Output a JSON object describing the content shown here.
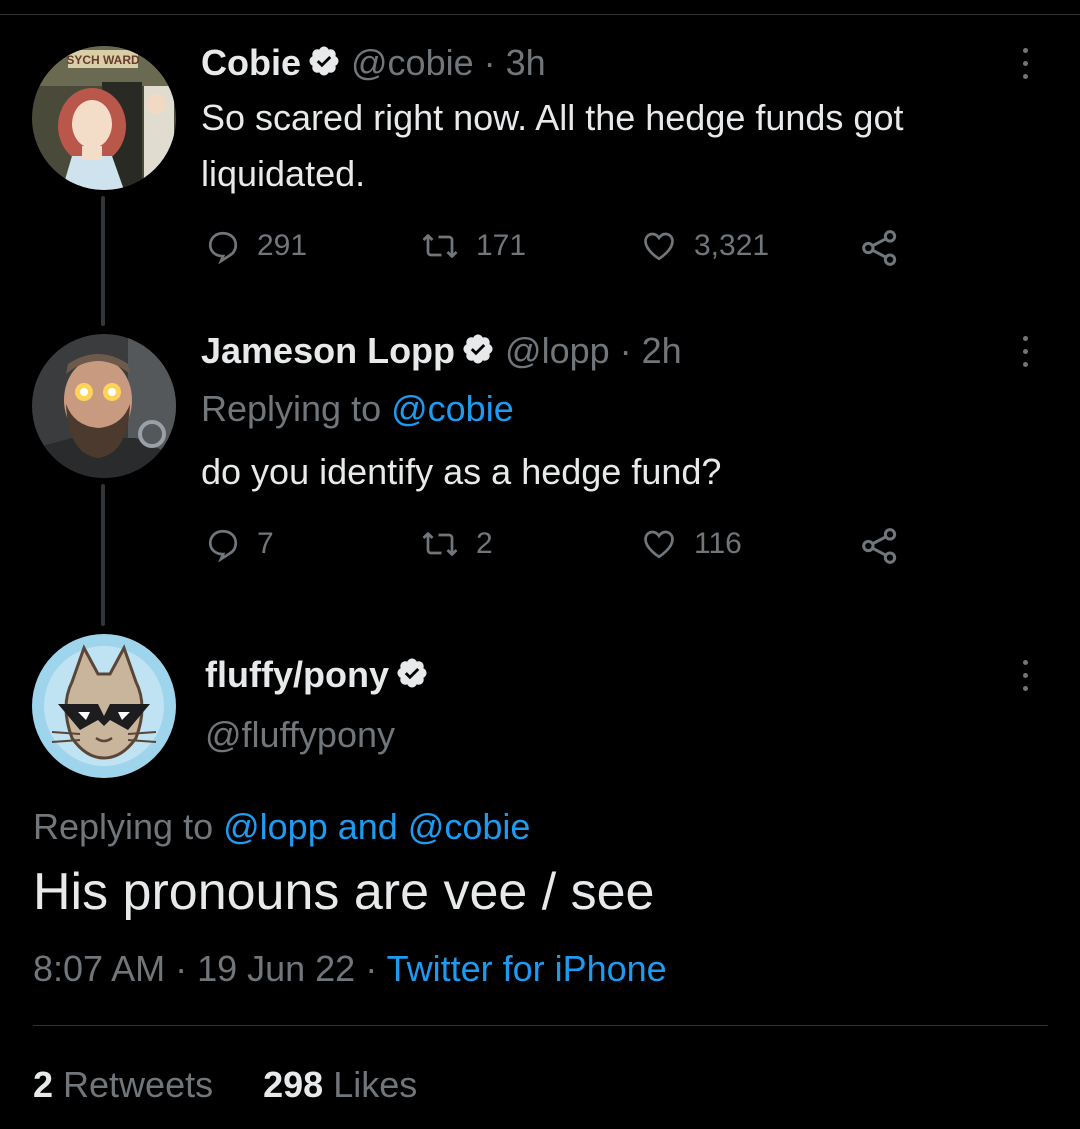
{
  "tweets": [
    {
      "name": "Cobie",
      "handle": "@cobie · 3h",
      "text": "So scared right now. All the hedge funds got liquidated.",
      "replies": "291",
      "retweets": "171",
      "likes": "3,321",
      "avatar_icon": "anime-nurse-avatar-icon",
      "avatar_sign": "SYCH WARD"
    },
    {
      "name": "Jameson Lopp",
      "handle": "@lopp · 2h",
      "replying_prefix": "Replying to ",
      "replying_to": "@cobie",
      "text": "do you identify as a hedge fund?",
      "replies": "7",
      "retweets": "2",
      "likes": "116",
      "avatar_icon": "bearded-man-glowing-eyes-avatar-icon"
    }
  ],
  "main_tweet": {
    "name": "fluffy/pony",
    "handle": "@fluffypony",
    "replying_prefix": "Replying to ",
    "replying_to": "@lopp and @cobie",
    "text": "His pronouns are vee / see",
    "time": "8:07 AM · 19 Jun 22 · ",
    "source": "Twitter for iPhone",
    "retweet_count": "2",
    "retweet_label": " Retweets",
    "like_count": "298",
    "like_label": " Likes",
    "avatar_icon": "cat-sunglasses-avatar-icon"
  },
  "colors": {
    "background": "#000000",
    "text": "#e7e9ea",
    "secondary": "#71767b",
    "link": "#1d9bf0",
    "divider": "#2f3336"
  }
}
